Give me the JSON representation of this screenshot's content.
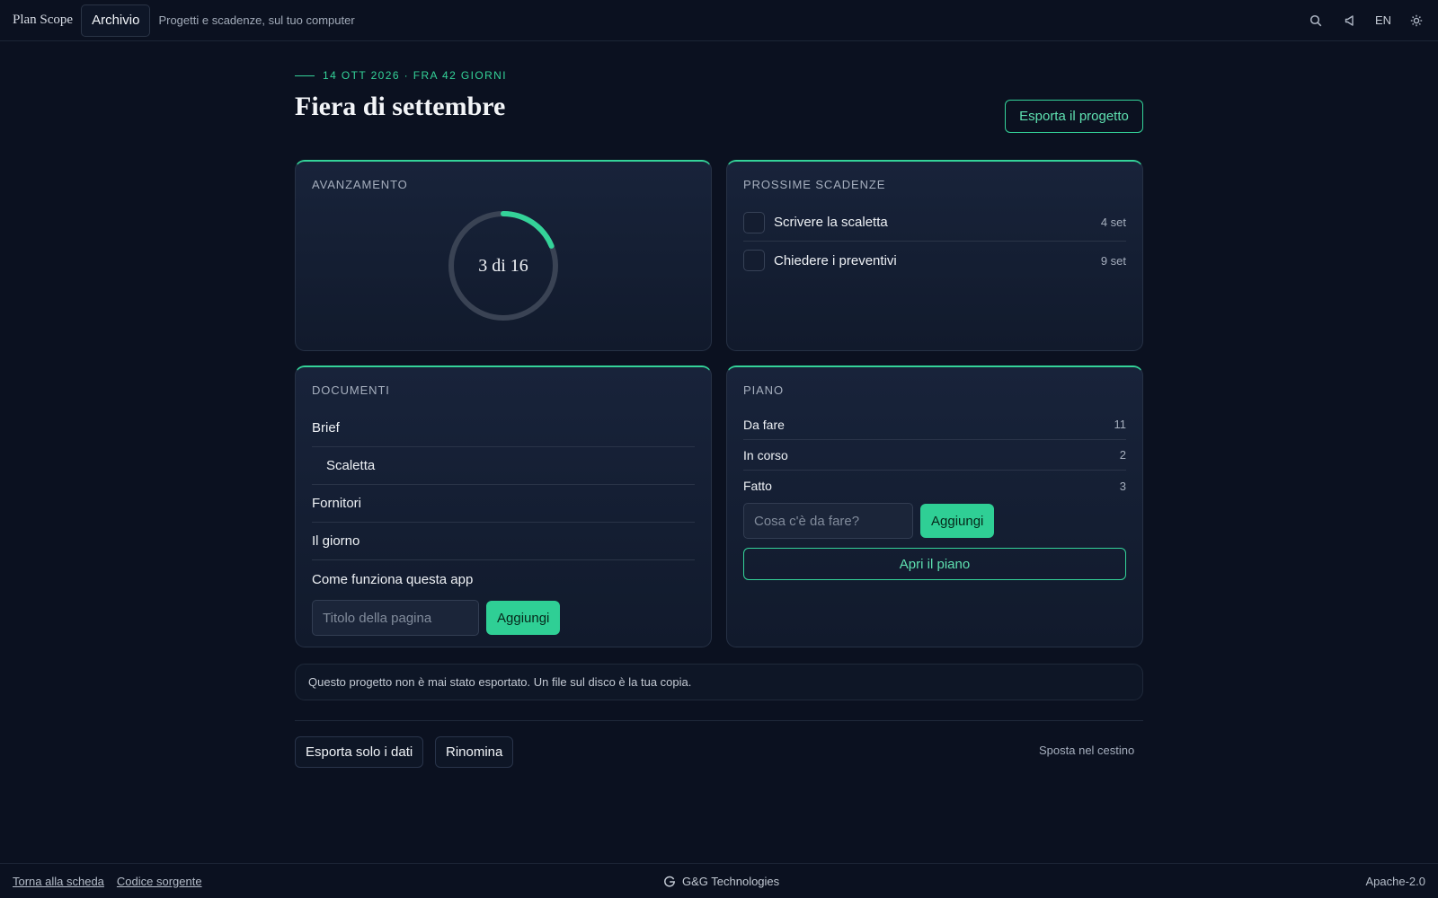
{
  "header": {
    "brand": "Plan Scope",
    "archive_label": "Archivio",
    "tagline": "Progetti e scadenze, sul tuo computer",
    "language": "EN",
    "icons": [
      "search-icon",
      "speaker-icon",
      "sun-icon"
    ]
  },
  "project": {
    "eyebrow": "14 OTT 2026 · FRA 42 GIORNI",
    "title": "Fiera di settembre",
    "export_label": "Esporta il progetto"
  },
  "progress": {
    "title": "AVANZAMENTO",
    "done": 3,
    "total": 16,
    "label": "3 di 16",
    "accent": "#34d399",
    "track": "#3a4354"
  },
  "deadlines": {
    "title": "PROSSIME SCADENZE",
    "items": [
      {
        "label": "Scrivere la scaletta",
        "date": "4 set"
      },
      {
        "label": "Chiedere i preventivi",
        "date": "9 set"
      }
    ]
  },
  "documents": {
    "title": "DOCUMENTI",
    "items": [
      {
        "label": "Brief",
        "indent": false
      },
      {
        "label": "Scaletta",
        "indent": true
      },
      {
        "label": "Fornitori",
        "indent": false
      },
      {
        "label": "Il giorno",
        "indent": false
      },
      {
        "label": "Come funziona questa app",
        "indent": false
      }
    ],
    "input_placeholder": "Titolo della pagina",
    "add_label": "Aggiungi"
  },
  "plan": {
    "title": "PIANO",
    "rows": [
      {
        "label": "Da fare",
        "count": "11"
      },
      {
        "label": "In corso",
        "count": "2"
      },
      {
        "label": "Fatto",
        "count": "3"
      }
    ],
    "input_placeholder": "Cosa c'è da fare?",
    "add_label": "Aggiungi",
    "open_label": "Apri il piano"
  },
  "notice": "Questo progetto non è mai stato esportato. Un file sul disco è la tua copia.",
  "actions": {
    "export_data": "Esporta solo i dati",
    "rename": "Rinomina",
    "trash": "Sposta nel cestino"
  },
  "footer": {
    "back_link": "Torna alla scheda",
    "source_link": "Codice sorgente",
    "company": "G&G Technologies",
    "license": "Apache-2.0"
  }
}
